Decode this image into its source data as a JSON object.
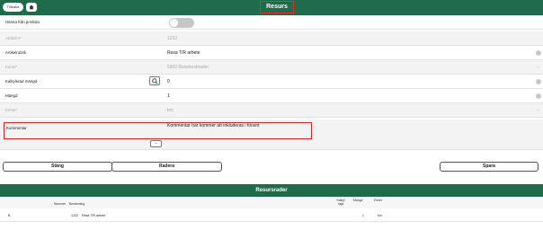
{
  "header": {
    "back_label": "Tillbaka",
    "title": "Resurs"
  },
  "form": {
    "hamta_label": "Hämta från prislista",
    "artikelnr_label": "Artikelnr*",
    "artikelnr_value": "1232",
    "artikelrubrik_label": "Artikelrubrik",
    "artikelrubrik_value": "Resa T/R arbete",
    "konto_label": "Konto*",
    "konto_value": "5800 Resekostnader",
    "kalkylerad_label": "Kalkylerad mängd",
    "kalkylerad_value": "0",
    "mangd_label": "Mängd",
    "mangd_value": "1",
    "enhet_label": "Enhet*",
    "enhet_value": "km",
    "kommentar_label": "Kommentar",
    "kommentar_value": "Kommentar här kommer att inkluderas i fönsnt",
    "dots_label": "..."
  },
  "buttons": {
    "stang": "Stäng",
    "radera": "Radera",
    "spara": "Spara"
  },
  "resursrader": {
    "title": "Resursrader",
    "headers": [
      "Nummer",
      "Benämning",
      "Kalkyl mgd",
      "Mängd",
      "Enhet"
    ],
    "rows": [
      {
        "col0": "B",
        "nummer": "1232",
        "benamning": "Resa T/R arbete",
        "kalkyl": "",
        "mangd": "1",
        "enhet": "km"
      }
    ]
  }
}
